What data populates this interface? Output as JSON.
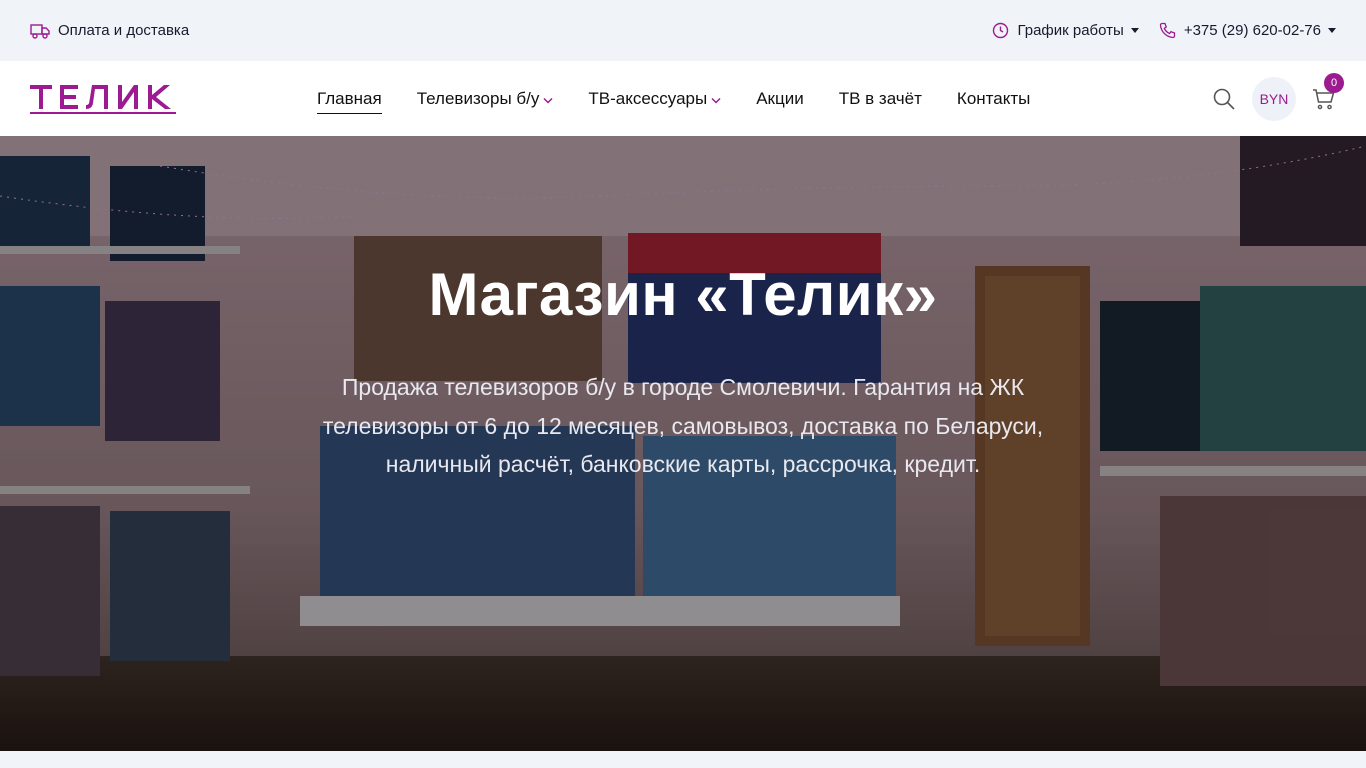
{
  "topbar": {
    "delivery_label": "Оплата и доставка",
    "schedule_label": "График работы",
    "phone_label": "+375 (29) 620-02-76"
  },
  "header": {
    "logo_text": "ТЕЛИК",
    "nav": [
      {
        "label": "Главная",
        "active": true,
        "has_dropdown": false
      },
      {
        "label": "Телевизоры б/у",
        "active": false,
        "has_dropdown": true
      },
      {
        "label": "ТВ-аксессуары",
        "active": false,
        "has_dropdown": true
      },
      {
        "label": "Акции",
        "active": false,
        "has_dropdown": false
      },
      {
        "label": "ТВ в зачёт",
        "active": false,
        "has_dropdown": false
      },
      {
        "label": "Контакты",
        "active": false,
        "has_dropdown": false
      }
    ],
    "currency_label": "BYN",
    "cart_count": "0"
  },
  "hero": {
    "title": "Магазин «Телик»",
    "text": "Продажа телевизоров б/у в городе Смолевичи. Гарантия на ЖК телевизоры от 6 до 12 месяцев, самовывоз, доставка по Беларуси, наличный расчёт, банковские карты, рассрочка, кредит."
  },
  "colors": {
    "brand": "#9c1b91",
    "topbar_bg": "#f0f3f8",
    "header_bg": "#ffffff"
  },
  "icons": [
    "truck-icon",
    "clock-icon",
    "phone-icon",
    "search-icon",
    "cart-icon",
    "chevron-down-icon"
  ]
}
